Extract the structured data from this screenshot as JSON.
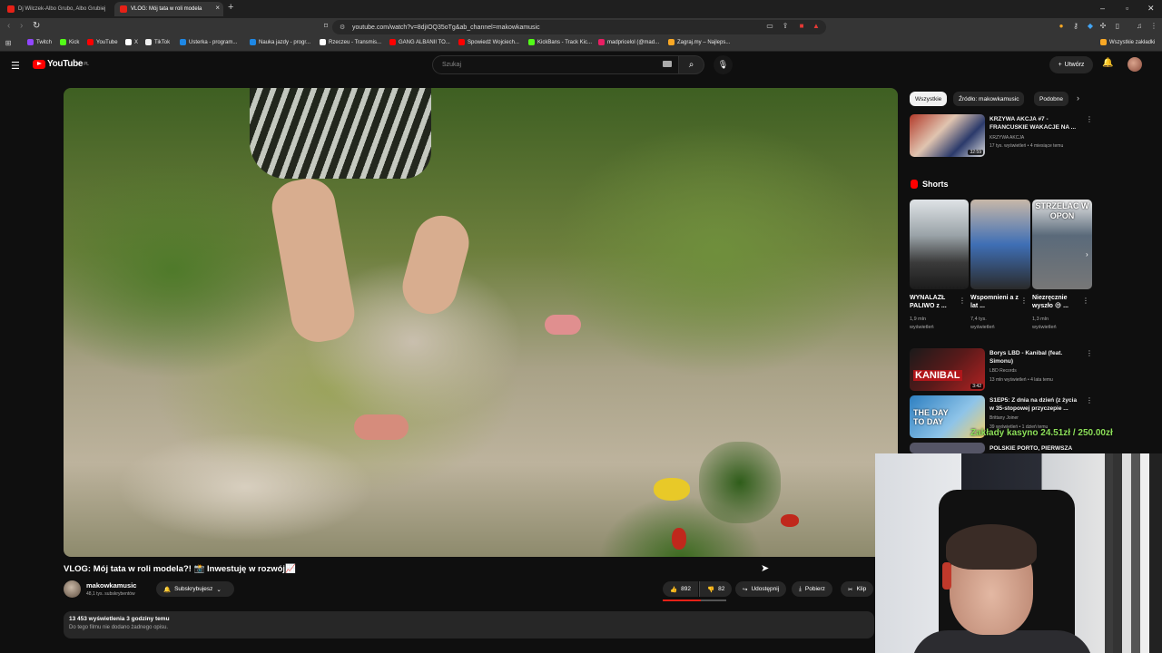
{
  "browser": {
    "tabs": [
      {
        "label": "Dj Wilczek-Albo Grubo, Albo Grubiej",
        "active": false
      },
      {
        "label": "VLOG: Mój tata w roli modela",
        "active": true
      }
    ],
    "url": "youtube.com/watch?v=8djIOQ35oTg&ab_channel=makowkamusic",
    "bookmarks": [
      {
        "label": "Twitch",
        "color": "#9146ff"
      },
      {
        "label": "Kick",
        "color": "#53fc18"
      },
      {
        "label": "YouTube",
        "color": "#ff0000"
      },
      {
        "label": "X",
        "color": "#ffffff"
      },
      {
        "label": "TikTok",
        "color": "#ffffff"
      },
      {
        "label": "Usterka - program...",
        "color": "#1e88e5"
      },
      {
        "label": "Nauka jazdy - progr...",
        "color": "#1e88e5"
      },
      {
        "label": "Rzeczeu - Transmis...",
        "color": "#ffffff"
      },
      {
        "label": "GANG ALBANII TO...",
        "color": "#ff0000"
      },
      {
        "label": "Spowiedź Wojciech...",
        "color": "#ff0000"
      },
      {
        "label": "KickBans - Track Kic...",
        "color": "#53fc18"
      },
      {
        "label": "madpricelol (@mad...",
        "color": "#e91e63"
      },
      {
        "label": "Zagraj.my – Najleps...",
        "color": "#f9a825"
      }
    ],
    "bookmarks_all": "Wszystkie zakładki"
  },
  "youtube": {
    "logo_text": "YouTube",
    "logo_region": "PL",
    "search_placeholder": "Szukaj",
    "create_label": "Utwórz"
  },
  "video": {
    "title": "VLOG: Mój tata w roli modela?! 📸 Inwestuję w rozwój📈",
    "channel": "makowkamusic",
    "subscribers": "48,1 tys. subskrybentów",
    "subscribe_label": "Subskrybujesz",
    "likes": "892",
    "dislikes": "82",
    "like_ratio": 0.6,
    "share_label": "Udostępnij",
    "download_label": "Pobierz",
    "clip_label": "Klip",
    "meta": "13 453 wyświetlenia  3 godziny temu",
    "description": "Do tego filmu nie dodano żadnego opisu."
  },
  "sidebar": {
    "chips": [
      {
        "label": "Wszystkie",
        "selected": true
      },
      {
        "label": "Źródło: makowkamusic",
        "selected": false
      },
      {
        "label": "Podobne",
        "selected": false
      }
    ],
    "top_item": {
      "title": "KRZYWA AKCJA #7 - FRANCUSKIE WAKACJE NA ...",
      "channel": "KRZYWA AKCJA",
      "meta": "17 tys. wyświetleń • 4 miesiące temu",
      "duration": "32:59"
    },
    "shorts_heading": "Shorts",
    "shorts": [
      {
        "title": "WYNALAZŁ PALIWO z ...",
        "views": "1,9 mln",
        "views2": "wyświetleń",
        "overlay": ""
      },
      {
        "title": "Wspomnieni a z lat ...",
        "views": "7,4 tys.",
        "views2": "wyświetleń",
        "overlay": ""
      },
      {
        "title": "Niezręcznie wyszło 😅 ...",
        "views": "1,3 mln",
        "views2": "wyświetleń",
        "overlay": "STRZELAC W OPON"
      }
    ],
    "items": [
      {
        "title": "Borys LBD - Kanibal (feat. Simonu)",
        "channel": "LBD Records",
        "meta": "13 mln wyświetleń • 4 lata temu",
        "duration": "3:42",
        "thumb_text": "KANIBAL"
      },
      {
        "title": "S1EP5: Z dnia na dzień (z życia w 35-stopowej przyczepie ...",
        "channel": "Brittany Joiner",
        "meta": "39 wyświetleń • 1 dzień temu",
        "duration": "",
        "thumb_text": "THE DAY TO DAY"
      },
      {
        "title": "POLSKIE PORTO, PIERWSZA",
        "channel": "",
        "meta": "",
        "duration": "",
        "thumb_text": ""
      }
    ]
  },
  "stream_overlay": "Zakłady kasyno 24.51zł / 250.00zł",
  "colors": {
    "background": "#0f0f0f",
    "accent": "#ff0000",
    "chip_bg": "#272727",
    "overlay_text": "#8de05a"
  }
}
